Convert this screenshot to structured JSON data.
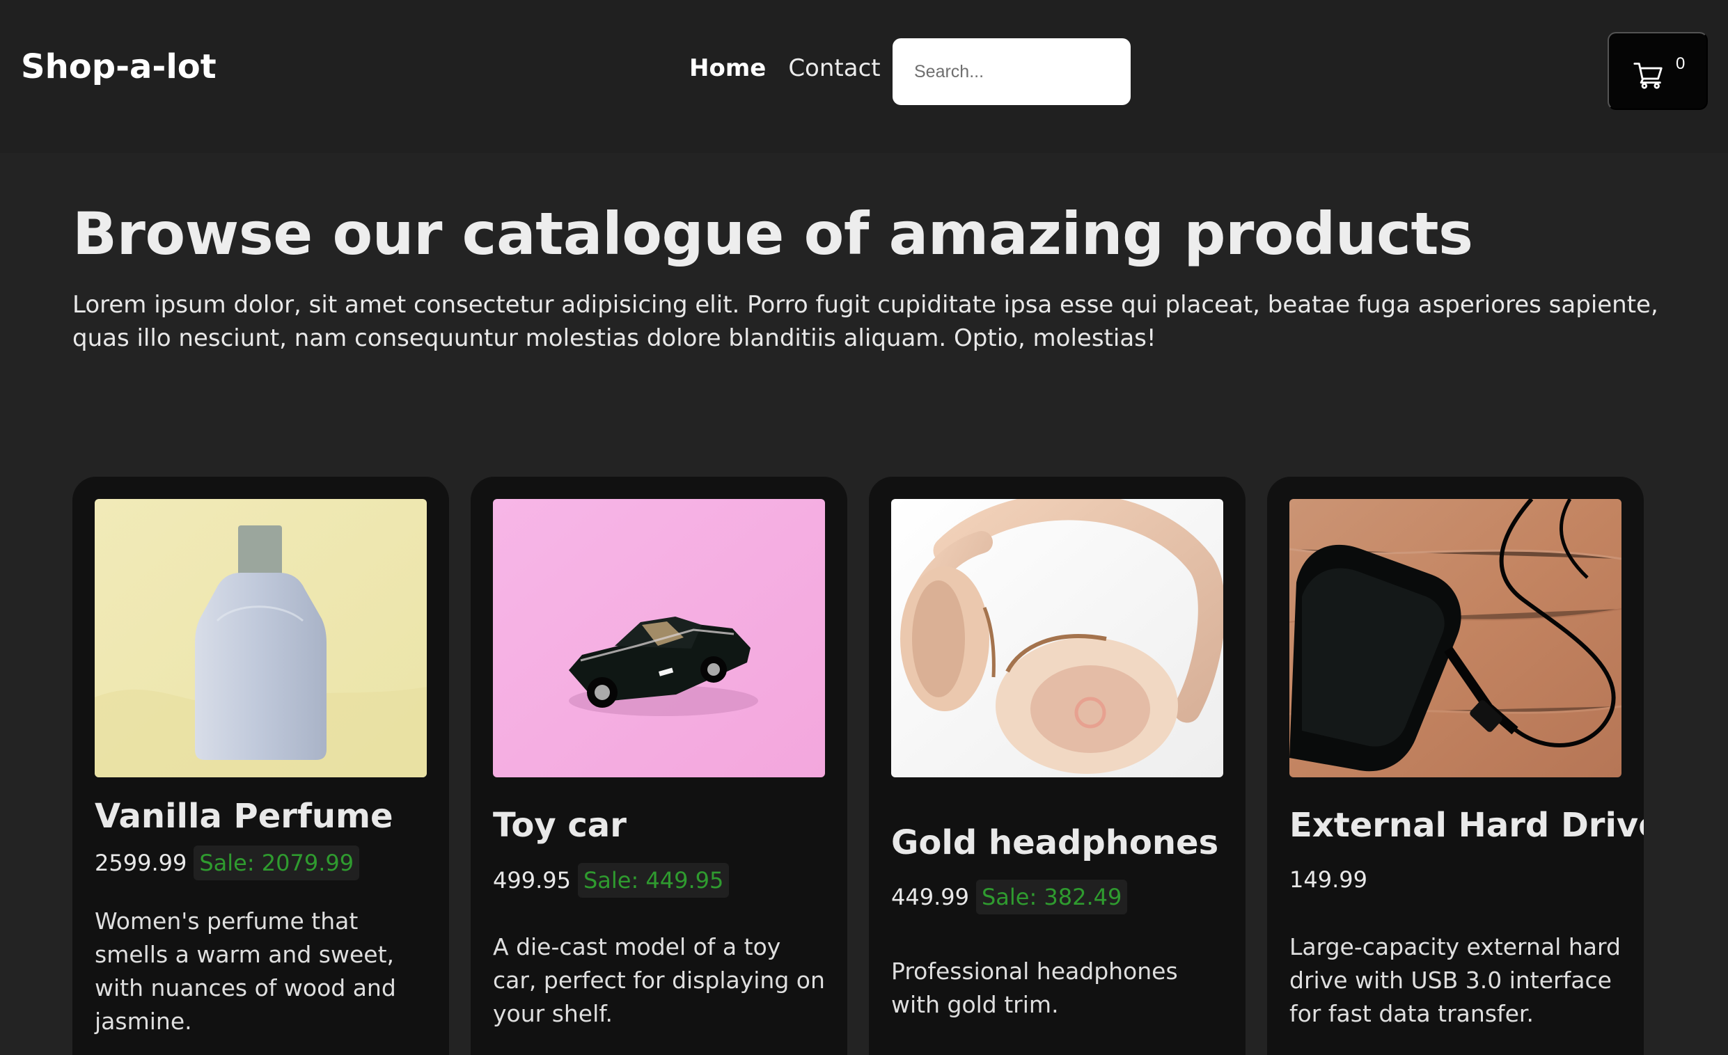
{
  "header": {
    "brand": "Shop-a-lot",
    "nav": {
      "home": "Home",
      "contact": "Contact"
    },
    "search": {
      "placeholder": "Search..."
    },
    "cart": {
      "icon": "cart-icon",
      "count": "0"
    }
  },
  "hero": {
    "title": "Browse our catalogue of amazing products",
    "text": "Lorem ipsum dolor, sit amet consectetur adipisicing elit. Porro fugit cupiditate ipsa esse qui placeat, beatae fuga asperiores sapiente, quas illo nesciunt, nam consequuntur molestias dolore blanditiis aliquam. Optio, molestias!"
  },
  "products": [
    {
      "name": "Vanilla Perfume",
      "price": "2599.99",
      "sale": "Sale: 2079.99",
      "description": "Women's perfume that smells a warm and sweet, with nuances of wood and jasmine.",
      "image": "perfume-bottle-image"
    },
    {
      "name": "Toy car",
      "price": "499.95",
      "sale": "Sale: 449.95",
      "description": "A die-cast model of a toy car, perfect for displaying on your shelf.",
      "image": "toy-car-image"
    },
    {
      "name": "Gold headphones",
      "price": "449.99",
      "sale": "Sale: 382.49",
      "description": "Professional headphones with gold trim.",
      "image": "gold-headphones-image"
    },
    {
      "name": "External Hard Drive",
      "price": "149.99",
      "description": "Large-capacity external hard drive with USB 3.0 interface for fast data transfer.",
      "image": "external-hard-drive-image"
    }
  ],
  "colors": {
    "page_background": "#232323",
    "card_background": "#111111",
    "sale_text": "#2f9b2f",
    "search_background": "#ffffff",
    "cart_background": "#050505"
  }
}
